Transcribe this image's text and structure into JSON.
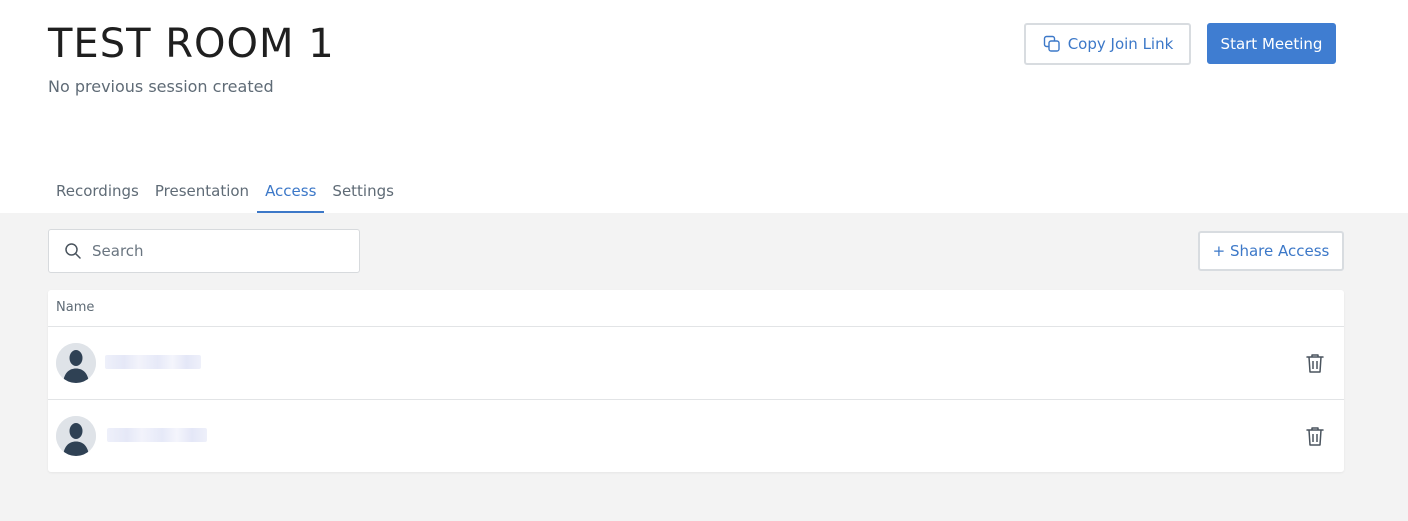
{
  "room": {
    "title": "TEST ROOM 1",
    "session_note": "No previous session created"
  },
  "actions": {
    "copy_link_label": "Copy Join Link",
    "copy_link_icon": "copy-icon",
    "start_meeting_label": "Start Meeting"
  },
  "tabs": [
    {
      "label": "Recordings",
      "active": false
    },
    {
      "label": "Presentation",
      "active": false
    },
    {
      "label": "Access",
      "active": true
    },
    {
      "label": "Settings",
      "active": false
    }
  ],
  "access": {
    "search_placeholder": "Search",
    "search_value": "",
    "search_icon": "search-icon",
    "share_label": "+ Share Access",
    "table": {
      "columns": [
        "Name"
      ],
      "rows": [
        {
          "avatar": "user-avatar-icon",
          "name_redacted": true,
          "delete_icon": "trash-icon"
        },
        {
          "avatar": "user-avatar-icon",
          "name_redacted": true,
          "delete_icon": "trash-icon"
        }
      ]
    }
  },
  "colors": {
    "accent": "#3f7dd1",
    "link": "#3c78c8",
    "content_bg": "#f3f3f3",
    "muted_text": "#5f6b76"
  }
}
